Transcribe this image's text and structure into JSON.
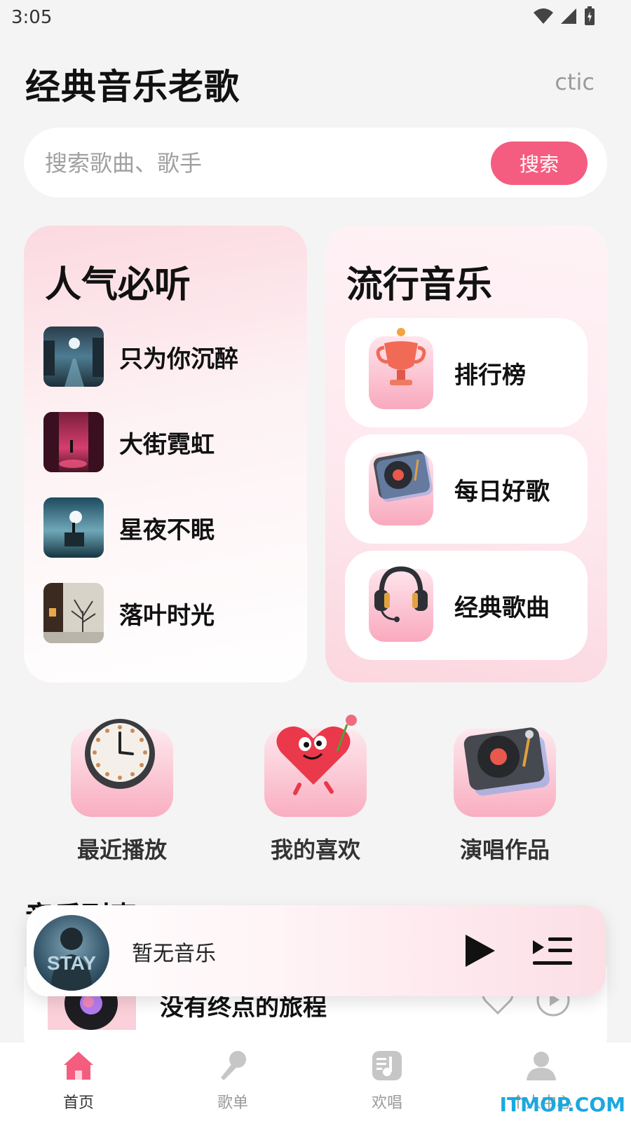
{
  "status_bar": {
    "time": "3:05"
  },
  "header": {
    "title": "经典音乐老歌",
    "right_text": "ctic"
  },
  "search": {
    "placeholder": "搜索歌曲、歌手",
    "button": "搜索"
  },
  "popular": {
    "title": "人气必听",
    "songs": [
      {
        "name": "只为你沉醉"
      },
      {
        "name": "大街霓虹"
      },
      {
        "name": "星夜不眠"
      },
      {
        "name": "落叶时光"
      }
    ]
  },
  "trending": {
    "title": "流行音乐",
    "tiles": [
      {
        "label": "排行榜",
        "icon": "trophy-icon"
      },
      {
        "label": "每日好歌",
        "icon": "turntable-icon"
      },
      {
        "label": "经典歌曲",
        "icon": "headphones-icon"
      }
    ]
  },
  "quick_actions": [
    {
      "label": "最近播放",
      "icon": "clock-icon"
    },
    {
      "label": "我的喜欢",
      "icon": "heart-icon"
    },
    {
      "label": "演唱作品",
      "icon": "turntable-icon"
    }
  ],
  "list_section": {
    "title": "音乐列表",
    "first_item": "没有终点的旅程"
  },
  "player": {
    "track": "暂无音乐",
    "cover_text": "STAY"
  },
  "tabs": [
    {
      "label": "首页",
      "active": true
    },
    {
      "label": "歌单",
      "active": false
    },
    {
      "label": "欢唱",
      "active": false
    },
    {
      "label": "个人中心",
      "active": false
    }
  ],
  "watermark": "ITMOP.COM",
  "colors": {
    "accent": "#f45d7f",
    "card_pink": "#fcd9e1",
    "background": "#f4f4f4"
  }
}
